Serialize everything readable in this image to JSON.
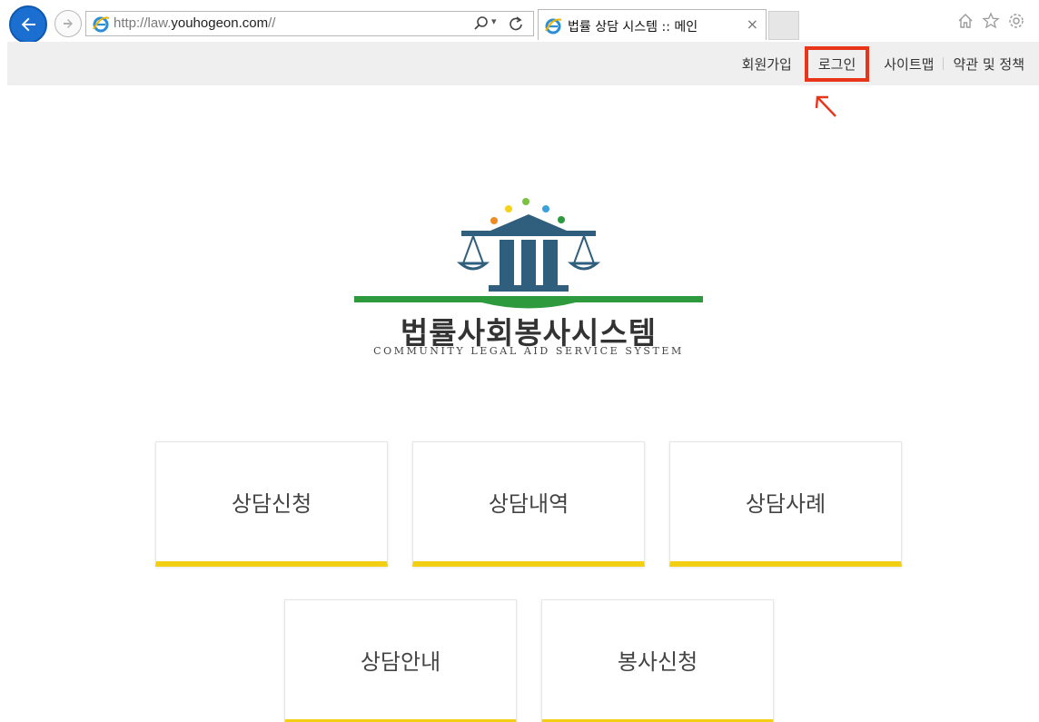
{
  "browser": {
    "url_prefix": "http://law.",
    "url_domain": "youhogeon.com",
    "url_suffix": "//",
    "tab_title": "법률 상담 시스템 :: 메인",
    "tab_close": "×"
  },
  "top_links": {
    "signup": "회원가입",
    "login": "로그인",
    "sitemap": "사이트맵",
    "terms": "약관 및 정책"
  },
  "logo": {
    "name_ko": "법률사회봉사시스템",
    "name_en": "COMMUNITY LEGAL AID SERVICE SYSTEM"
  },
  "menu": {
    "row1": [
      "상담신청",
      "상담내역",
      "상담사례"
    ],
    "row2": [
      "상담안내",
      "봉사신청"
    ]
  },
  "colors": {
    "accent_yellow": "#f2cf12",
    "highlight_red": "#e8351a",
    "logo_blue": "#2f5f7d",
    "logo_green": "#2e9a3e"
  }
}
